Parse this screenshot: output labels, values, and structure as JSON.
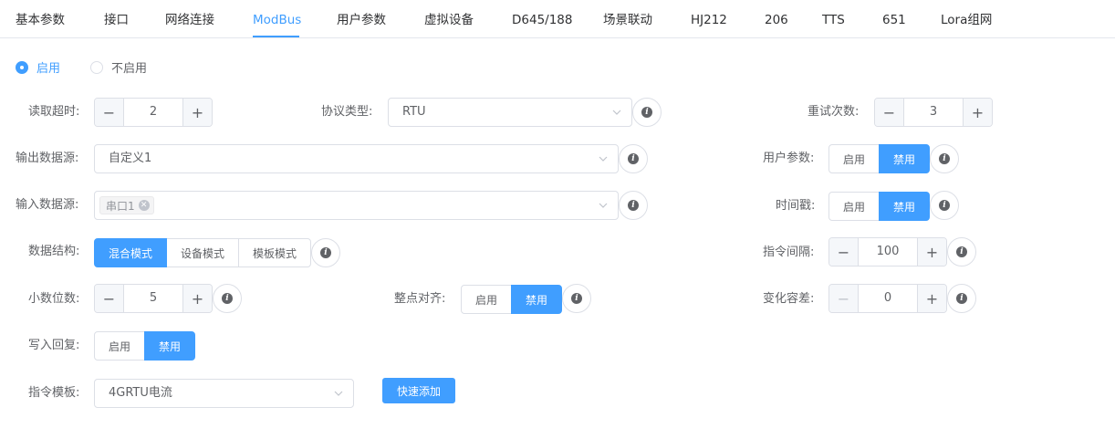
{
  "tabs": [
    {
      "label": "基本参数"
    },
    {
      "label": "接口"
    },
    {
      "label": "网络连接"
    },
    {
      "label": "ModBus"
    },
    {
      "label": "用户参数"
    },
    {
      "label": "虚拟设备"
    },
    {
      "label": "D645/188"
    },
    {
      "label": "场景联动"
    },
    {
      "label": "HJ212"
    },
    {
      "label": "206"
    },
    {
      "label": "TTS"
    },
    {
      "label": "651"
    },
    {
      "label": "Lora组网"
    }
  ],
  "active_tab": "ModBus",
  "enable_radio": {
    "on_label": "启用",
    "off_label": "不启用",
    "selected": "启用"
  },
  "read_timeout": {
    "label": "读取超时:",
    "value": "2"
  },
  "protocol_type": {
    "label": "协议类型:",
    "value": "RTU"
  },
  "retry_count": {
    "label": "重试次数:",
    "value": "3"
  },
  "output_source": {
    "label": "输出数据源:",
    "value": "自定义1"
  },
  "user_params": {
    "label": "用户参数:",
    "on": "启用",
    "off": "禁用",
    "selected": "禁用"
  },
  "input_source": {
    "label": "输入数据源:",
    "tag": "串口1"
  },
  "timestamp": {
    "label": "时间戳:",
    "on": "启用",
    "off": "禁用",
    "selected": "禁用"
  },
  "data_structure": {
    "label": "数据结构:",
    "options": [
      "混合模式",
      "设备模式",
      "模板模式"
    ],
    "selected": "混合模式"
  },
  "command_interval": {
    "label": "指令间隔:",
    "value": "100"
  },
  "decimal_places": {
    "label": "小数位数:",
    "value": "5"
  },
  "hour_align": {
    "label": "整点对齐:",
    "on": "启用",
    "off": "禁用",
    "selected": "禁用"
  },
  "change_tolerance": {
    "label": "变化容差:",
    "value": "0"
  },
  "write_reply": {
    "label": "写入回复:",
    "on": "启用",
    "off": "禁用",
    "selected": "禁用"
  },
  "command_template": {
    "label": "指令模板:",
    "value": "4GRTU电流",
    "quick_add": "快速添加"
  },
  "stepper_symbols": {
    "minus": "−",
    "plus": "+"
  },
  "info_glyph": "i",
  "colors": {
    "accent": "#409eff",
    "border": "#dcdfe6",
    "text": "#606266"
  }
}
